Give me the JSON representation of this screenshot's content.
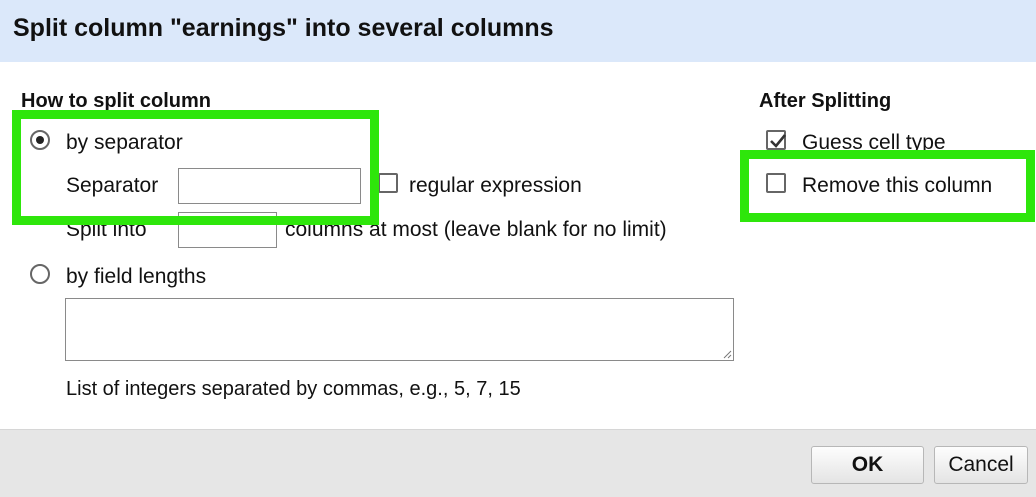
{
  "dialog": {
    "title": "Split column \"earnings\" into several columns"
  },
  "how_to_split": {
    "heading": "How to split column",
    "by_separator": {
      "label": "by separator",
      "selected": true,
      "separator_label": "Separator",
      "separator_value": "",
      "regex_label": "regular expression",
      "regex_checked": false,
      "split_into_label": "Split into",
      "split_into_value": "",
      "split_into_suffix": "columns at most (leave blank for no limit)"
    },
    "by_field_lengths": {
      "label": "by field lengths",
      "selected": false,
      "value": "",
      "hint": "List of integers separated by commas, e.g., 5, 7, 15"
    }
  },
  "after_splitting": {
    "heading": "After Splitting",
    "guess_cell_type": {
      "label": "Guess cell type",
      "checked": true
    },
    "remove_column": {
      "label": "Remove this column",
      "checked": false
    }
  },
  "footer": {
    "ok_label": "OK",
    "cancel_label": "Cancel"
  },
  "colors": {
    "title_bar": "#dbe8fa",
    "highlight": "#2ee60b",
    "footer": "#e6e6e6"
  }
}
